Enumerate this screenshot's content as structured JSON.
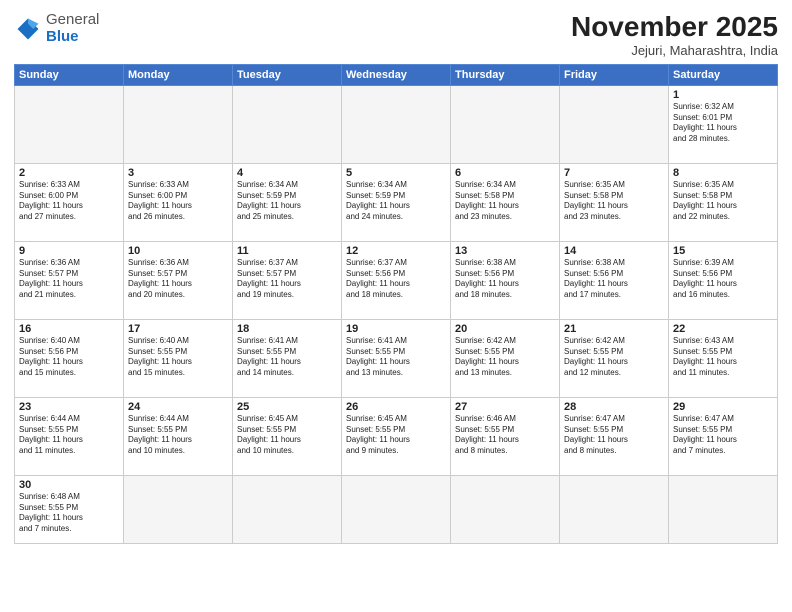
{
  "header": {
    "logo_general": "General",
    "logo_blue": "Blue",
    "month_title": "November 2025",
    "subtitle": "Jejuri, Maharashtra, India"
  },
  "days_header": [
    "Sunday",
    "Monday",
    "Tuesday",
    "Wednesday",
    "Thursday",
    "Friday",
    "Saturday"
  ],
  "weeks": [
    [
      {
        "day": "",
        "text": ""
      },
      {
        "day": "",
        "text": ""
      },
      {
        "day": "",
        "text": ""
      },
      {
        "day": "",
        "text": ""
      },
      {
        "day": "",
        "text": ""
      },
      {
        "day": "",
        "text": ""
      },
      {
        "day": "1",
        "text": "Sunrise: 6:32 AM\nSunset: 6:01 PM\nDaylight: 11 hours\nand 28 minutes."
      }
    ],
    [
      {
        "day": "2",
        "text": "Sunrise: 6:33 AM\nSunset: 6:00 PM\nDaylight: 11 hours\nand 27 minutes."
      },
      {
        "day": "3",
        "text": "Sunrise: 6:33 AM\nSunset: 6:00 PM\nDaylight: 11 hours\nand 26 minutes."
      },
      {
        "day": "4",
        "text": "Sunrise: 6:34 AM\nSunset: 5:59 PM\nDaylight: 11 hours\nand 25 minutes."
      },
      {
        "day": "5",
        "text": "Sunrise: 6:34 AM\nSunset: 5:59 PM\nDaylight: 11 hours\nand 24 minutes."
      },
      {
        "day": "6",
        "text": "Sunrise: 6:34 AM\nSunset: 5:58 PM\nDaylight: 11 hours\nand 23 minutes."
      },
      {
        "day": "7",
        "text": "Sunrise: 6:35 AM\nSunset: 5:58 PM\nDaylight: 11 hours\nand 23 minutes."
      },
      {
        "day": "8",
        "text": "Sunrise: 6:35 AM\nSunset: 5:58 PM\nDaylight: 11 hours\nand 22 minutes."
      }
    ],
    [
      {
        "day": "9",
        "text": "Sunrise: 6:36 AM\nSunset: 5:57 PM\nDaylight: 11 hours\nand 21 minutes."
      },
      {
        "day": "10",
        "text": "Sunrise: 6:36 AM\nSunset: 5:57 PM\nDaylight: 11 hours\nand 20 minutes."
      },
      {
        "day": "11",
        "text": "Sunrise: 6:37 AM\nSunset: 5:57 PM\nDaylight: 11 hours\nand 19 minutes."
      },
      {
        "day": "12",
        "text": "Sunrise: 6:37 AM\nSunset: 5:56 PM\nDaylight: 11 hours\nand 18 minutes."
      },
      {
        "day": "13",
        "text": "Sunrise: 6:38 AM\nSunset: 5:56 PM\nDaylight: 11 hours\nand 18 minutes."
      },
      {
        "day": "14",
        "text": "Sunrise: 6:38 AM\nSunset: 5:56 PM\nDaylight: 11 hours\nand 17 minutes."
      },
      {
        "day": "15",
        "text": "Sunrise: 6:39 AM\nSunset: 5:56 PM\nDaylight: 11 hours\nand 16 minutes."
      }
    ],
    [
      {
        "day": "16",
        "text": "Sunrise: 6:40 AM\nSunset: 5:56 PM\nDaylight: 11 hours\nand 15 minutes."
      },
      {
        "day": "17",
        "text": "Sunrise: 6:40 AM\nSunset: 5:55 PM\nDaylight: 11 hours\nand 15 minutes."
      },
      {
        "day": "18",
        "text": "Sunrise: 6:41 AM\nSunset: 5:55 PM\nDaylight: 11 hours\nand 14 minutes."
      },
      {
        "day": "19",
        "text": "Sunrise: 6:41 AM\nSunset: 5:55 PM\nDaylight: 11 hours\nand 13 minutes."
      },
      {
        "day": "20",
        "text": "Sunrise: 6:42 AM\nSunset: 5:55 PM\nDaylight: 11 hours\nand 13 minutes."
      },
      {
        "day": "21",
        "text": "Sunrise: 6:42 AM\nSunset: 5:55 PM\nDaylight: 11 hours\nand 12 minutes."
      },
      {
        "day": "22",
        "text": "Sunrise: 6:43 AM\nSunset: 5:55 PM\nDaylight: 11 hours\nand 11 minutes."
      }
    ],
    [
      {
        "day": "23",
        "text": "Sunrise: 6:44 AM\nSunset: 5:55 PM\nDaylight: 11 hours\nand 11 minutes."
      },
      {
        "day": "24",
        "text": "Sunrise: 6:44 AM\nSunset: 5:55 PM\nDaylight: 11 hours\nand 10 minutes."
      },
      {
        "day": "25",
        "text": "Sunrise: 6:45 AM\nSunset: 5:55 PM\nDaylight: 11 hours\nand 10 minutes."
      },
      {
        "day": "26",
        "text": "Sunrise: 6:45 AM\nSunset: 5:55 PM\nDaylight: 11 hours\nand 9 minutes."
      },
      {
        "day": "27",
        "text": "Sunrise: 6:46 AM\nSunset: 5:55 PM\nDaylight: 11 hours\nand 8 minutes."
      },
      {
        "day": "28",
        "text": "Sunrise: 6:47 AM\nSunset: 5:55 PM\nDaylight: 11 hours\nand 8 minutes."
      },
      {
        "day": "29",
        "text": "Sunrise: 6:47 AM\nSunset: 5:55 PM\nDaylight: 11 hours\nand 7 minutes."
      }
    ],
    [
      {
        "day": "30",
        "text": "Sunrise: 6:48 AM\nSunset: 5:55 PM\nDaylight: 11 hours\nand 7 minutes."
      },
      {
        "day": "",
        "text": ""
      },
      {
        "day": "",
        "text": ""
      },
      {
        "day": "",
        "text": ""
      },
      {
        "day": "",
        "text": ""
      },
      {
        "day": "",
        "text": ""
      },
      {
        "day": "",
        "text": ""
      }
    ]
  ]
}
